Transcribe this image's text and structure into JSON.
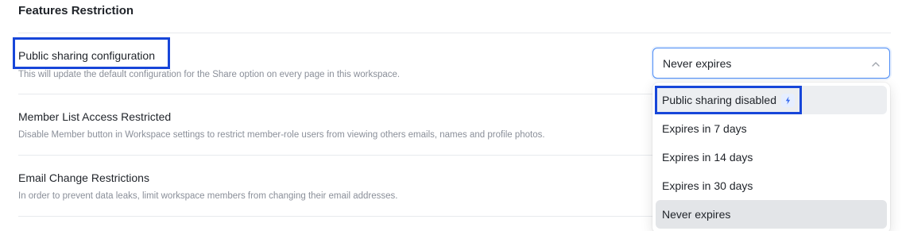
{
  "section": {
    "title": "Features Restriction"
  },
  "settings": [
    {
      "title": "Public sharing configuration",
      "description": "This will update the default configuration for the Share option on every page in this workspace."
    },
    {
      "title": "Member List Access Restricted",
      "description": "Disable Member button in Workspace settings to restrict member-role users from viewing others emails, names and profile photos."
    },
    {
      "title": "Email Change Restrictions",
      "description": "In order to prevent data leaks, limit workspace members from changing their email addresses."
    }
  ],
  "select": {
    "value": "Never expires",
    "icon": "chevron-up-icon"
  },
  "dropdown": {
    "options": [
      {
        "label": "Public sharing disabled",
        "badge_icon": "lightning-bolt-icon"
      },
      {
        "label": "Expires in 7 days"
      },
      {
        "label": "Expires in 14 days"
      },
      {
        "label": "Expires in 30 days"
      },
      {
        "label": "Never expires",
        "selected": true
      }
    ]
  },
  "colors": {
    "highlight": "#1746d9",
    "focus_border": "#4c8cf5",
    "badge_bg": "#e6eeff",
    "bolt": "#3a6df0"
  }
}
